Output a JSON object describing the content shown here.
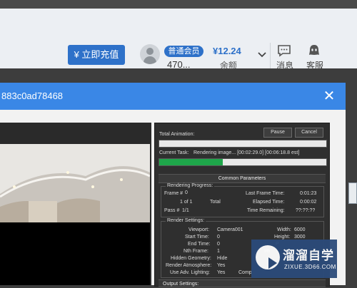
{
  "header": {
    "recharge_label": "¥ 立即充值",
    "member_badge": "普通会员",
    "user_id": "470...",
    "balance": "¥12.24",
    "balance_label": "余额",
    "messages_label": "消息",
    "service_label": "客服"
  },
  "dialog": {
    "title": "883c0ad78468",
    "close_glyph": "✕"
  },
  "render": {
    "total_animation_label": "Total Animation:",
    "pause_label": "Pause",
    "cancel_label": "Cancel",
    "current_task_label": "Current Task:",
    "current_task_value": "Rendering image... [00:02:29.0] [00:06:18.8 est]",
    "total_progress": 0,
    "task_progress": 0.38,
    "common_parameters": "Common Parameters",
    "rendering_progress": {
      "title": "Rendering Progress:",
      "frame_label": "Frame #",
      "frame_value": "0",
      "one_of_one": "1 of 1",
      "total_label": "Total",
      "pass_label": "Pass #",
      "pass_value": "1/1",
      "last_frame_time_label": "Last Frame Time:",
      "last_frame_time_value": "0:01:23",
      "elapsed_time_label": "Elapsed Time:",
      "elapsed_time_value": "0:00:02",
      "time_remaining_label": "Time Remaining:",
      "time_remaining_value": "??:??:??"
    },
    "render_settings": {
      "title": "Render Settings:",
      "viewport_label": "Viewport:",
      "viewport_value": "Camera001",
      "width_label": "Width:",
      "width_value": "6000",
      "start_time_label": "Start Time:",
      "start_time_value": "0",
      "height_label": "Height:",
      "height_value": "3000",
      "end_time_label": "End Time:",
      "end_time_value": "0",
      "end_time_right": "P",
      "nth_frame_label": "Nth Frame:",
      "nth_frame_value": "1",
      "nth_frame_right": "Im",
      "hidden_geometry_label": "Hidden Geometry:",
      "hidden_geometry_value": "Hide",
      "render_atmosphere_label": "Render Atmosphere:",
      "render_atmosphere_value": "Yes",
      "adv_lighting_label": "Use Adv. Lighting:",
      "adv_lighting_value": "Yes",
      "adv_lighting_right": "Comp"
    },
    "output_settings": "Output Settings:"
  },
  "watermark": {
    "brand": "溜溜自学",
    "url": "ZIXUE.3D66.COM"
  },
  "colors": {
    "accent_blue": "#3a87e6",
    "button_blue": "#2e71c9",
    "progress_green": "#1ea64a"
  }
}
